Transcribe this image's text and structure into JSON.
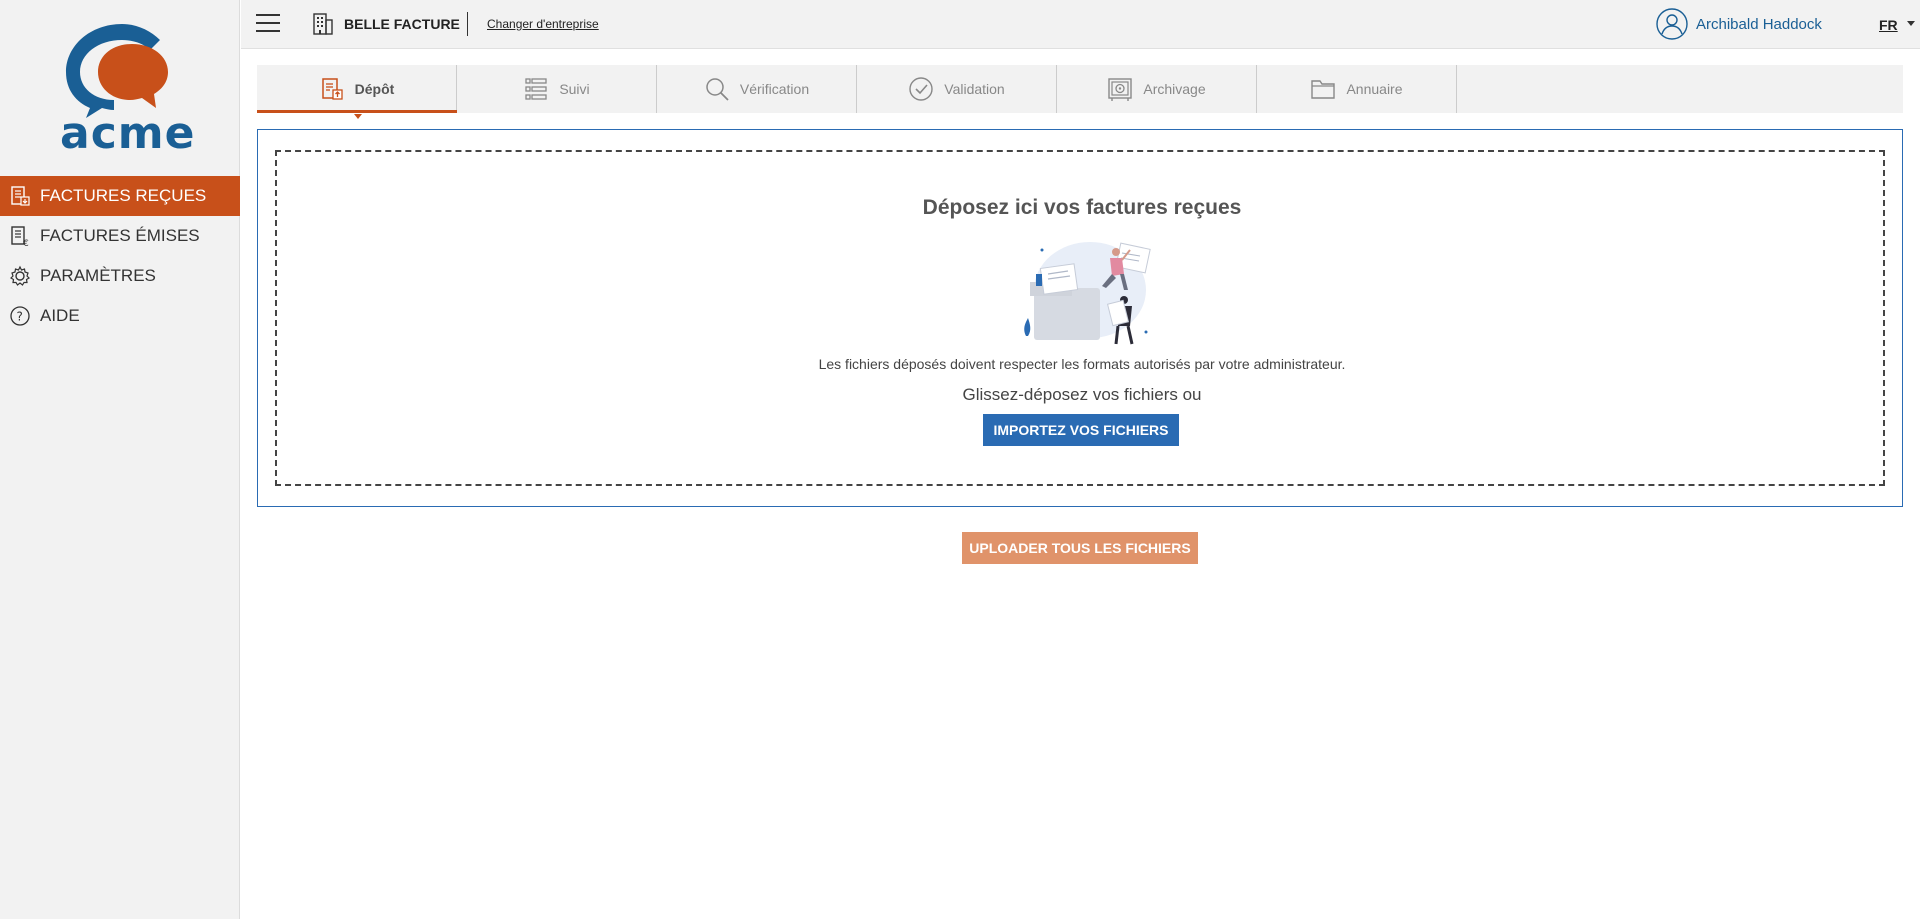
{
  "brand": {
    "logo_text": "acme",
    "primary_color": "#1a5f95",
    "accent_color": "#c8501a"
  },
  "sidebar": {
    "items": [
      {
        "label": "FACTURES REÇUES",
        "icon": "received-invoices-icon",
        "active": true
      },
      {
        "label": "FACTURES ÉMISES",
        "icon": "issued-invoices-icon",
        "active": false
      },
      {
        "label": "PARAMÈTRES",
        "icon": "settings-gear-icon",
        "active": false
      },
      {
        "label": "AIDE",
        "icon": "help-icon",
        "active": false
      }
    ]
  },
  "topbar": {
    "company_name": "BELLE FACTURE",
    "change_company_label": "Changer d'entreprise",
    "user_name": "Archibald Haddock",
    "language": "FR"
  },
  "tabs": [
    {
      "label": "Dépôt",
      "icon": "deposit-icon",
      "active": true
    },
    {
      "label": "Suivi",
      "icon": "list-icon",
      "active": false
    },
    {
      "label": "Vérification",
      "icon": "search-icon",
      "active": false
    },
    {
      "label": "Validation",
      "icon": "check-circle-icon",
      "active": false
    },
    {
      "label": "Archivage",
      "icon": "safe-icon",
      "active": false
    },
    {
      "label": "Annuaire",
      "icon": "folder-icon",
      "active": false
    }
  ],
  "dropzone": {
    "title": "Déposez ici vos factures reçues",
    "info": "Les fichiers déposés doivent respecter les formats autorisés par votre administrateur.",
    "dnd_text": "Glissez-déposez vos fichiers ou",
    "import_button": "IMPORTEZ VOS FICHIERS"
  },
  "upload_button": "UPLOADER TOUS LES FICHIERS"
}
